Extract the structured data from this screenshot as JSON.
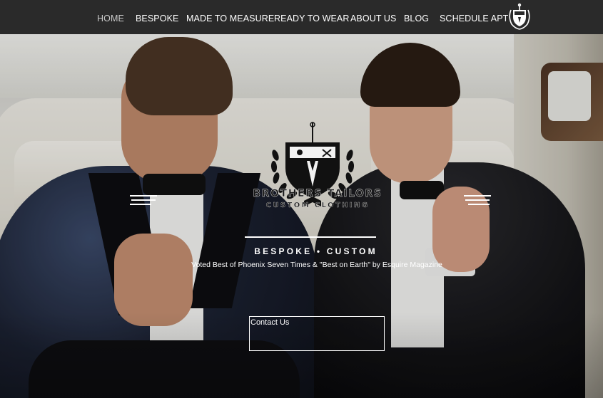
{
  "nav": {
    "items": [
      {
        "label": "HOME",
        "active": true
      },
      {
        "label": "BESPOKE",
        "active": false
      },
      {
        "label": "MADE TO MEASURE",
        "active": false
      },
      {
        "label": "READY TO WEAR",
        "active": false
      },
      {
        "label": "ABOUT US",
        "active": false
      },
      {
        "label": "BLOG",
        "active": false
      },
      {
        "label": "SCHEDULE APT",
        "active": false
      }
    ],
    "logo_icon": "crest-logo-icon"
  },
  "hero": {
    "brand_name": "BROTHERS TAILORS",
    "brand_subtitle": "CUSTOM CLOTHING",
    "tagline": "BESPOKE • CUSTOM",
    "subtagline": "Voted Best of Phoenix Seven Times & \"Best on Earth\" by Esquire Magazine",
    "cta_label": "Contact Us"
  },
  "colors": {
    "nav_background": "#2a2a2a",
    "nav_text": "#ffffff",
    "nav_active": "#c9c9c9",
    "overlay_text": "#ffffff"
  }
}
